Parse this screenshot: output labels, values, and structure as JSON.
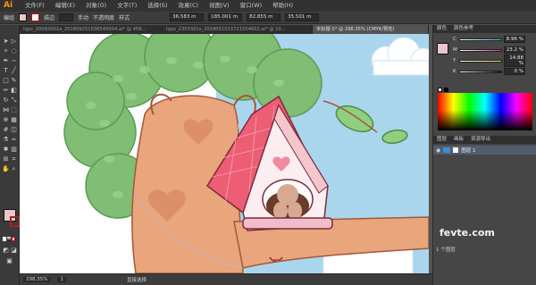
{
  "app": {
    "logo": "Ai"
  },
  "menu": {
    "items": [
      "文件(F)",
      "编辑(E)",
      "对象(O)",
      "文字(T)",
      "选择(S)",
      "效果(C)",
      "视图(V)",
      "窗口(W)",
      "帮助(H)"
    ]
  },
  "controlbar": {
    "selection_label": "编组",
    "stroke_label": "描边",
    "stroke_value": "",
    "brush_label": "手动",
    "opacity_label": "不透明度",
    "style_label": "样式",
    "x_value": "36.583 m",
    "y_value": "185.001 m",
    "w_value": "82.855 m",
    "h_value": "35.501 m"
  },
  "tabs": [
    {
      "label": "hjpx_20082001a_201809251638540004.ai* @ 458...",
      "active": false
    },
    {
      "label": "hjpx_2303301s_2018051013721554602.ai* @ 10...",
      "active": false
    },
    {
      "label": "未标题-1* @ 298.35% (CMYK/预览)",
      "active": true
    }
  ],
  "color_panel": {
    "tabs": [
      "颜色",
      "颜色参考"
    ],
    "sliders": [
      {
        "label": "C",
        "value": "8.96 %",
        "color": "#2fb7d4"
      },
      {
        "label": "M",
        "value": "23.2 %",
        "color": "#d8307e"
      },
      {
        "label": "Y",
        "value": "14.88 %",
        "color": "#e6d43a"
      },
      {
        "label": "K",
        "value": "0 %",
        "color": "#333333"
      }
    ],
    "fill_color": "#e9c6cc"
  },
  "layers_panel": {
    "tabs": [
      "图层",
      "画板",
      "资源导出"
    ],
    "layer_name": "图层 1",
    "footer": "1 个图层"
  },
  "status": {
    "zoom": "298.35%",
    "page": "1",
    "tool_label": "直接选择"
  },
  "watermark": "fevte.com"
}
